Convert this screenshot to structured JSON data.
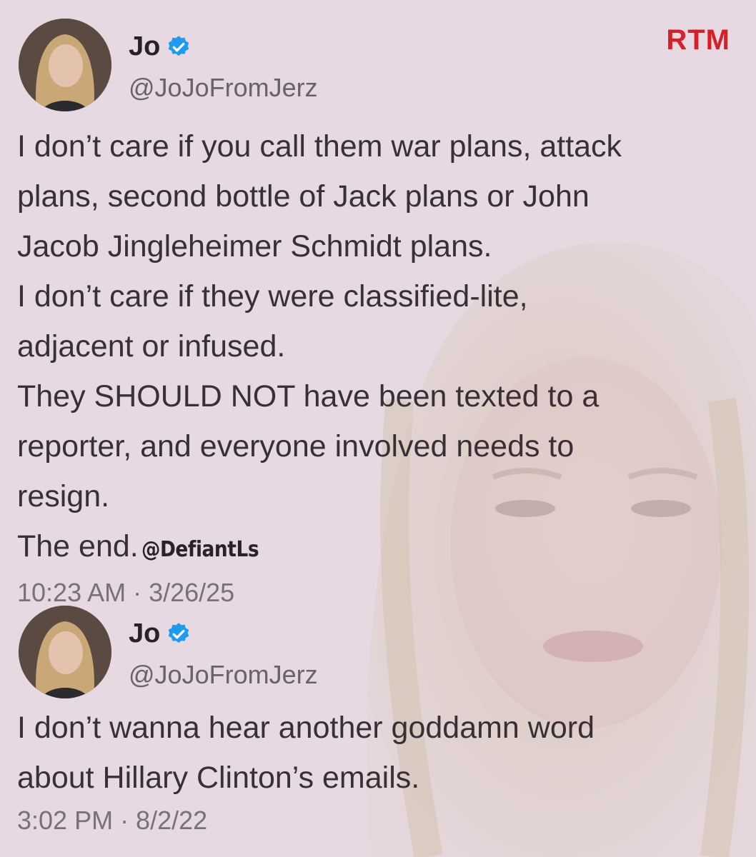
{
  "watermark": {
    "logo_text": "RTM",
    "color": "#d61f26"
  },
  "tweets": [
    {
      "author_name": "Jo",
      "verified_icon": "verified-badge-icon",
      "handle": "@JoJoFromJerz",
      "lines": [
        "I don’t care if you call them war plans, attack",
        "plans, second bottle of Jack plans or John",
        "Jacob Jingleheimer Schmidt plans.",
        "I don’t care if they were classified-lite,",
        "adjacent or infused.",
        "They SHOULD NOT have been texted to a",
        "reporter, and everyone involved needs to",
        "resign.",
        "The end."
      ],
      "inline_tag": "@DefiantLs",
      "timestamp": "10:23 AM · 3/26/25"
    },
    {
      "author_name": "Jo",
      "verified_icon": "verified-badge-icon",
      "handle": "@JoJoFromJerz",
      "lines": [
        "I don’t wanna hear another goddamn word",
        "about Hillary Clinton’s emails."
      ],
      "timestamp": "3:02 PM · 8/2/22"
    }
  ],
  "colors": {
    "background": "#e6d9e1",
    "verified_blue": "#1d9bf0",
    "text": "#3a2f37",
    "muted": "#7b7077"
  }
}
